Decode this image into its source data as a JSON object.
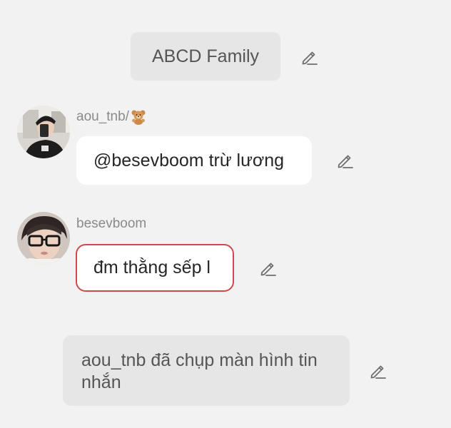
{
  "chat": {
    "group_name": "ABCD Family",
    "messages": [
      {
        "username": "aou_tnb/",
        "username_emoji": "teddy-bear",
        "text": "@besevboom trừ lương"
      },
      {
        "username": "besevboom",
        "text": "đm thằng sếp l"
      }
    ],
    "system_notice": "aou_tnb đã chụp màn hình tin nhắn"
  },
  "colors": {
    "background": "#f2f2f2",
    "pill": "#e6e6e6",
    "bubble": "#ffffff",
    "highlight_border": "#d04a4a",
    "muted_text": "#8a8a8a",
    "icon": "#6e6e6e"
  },
  "icons": {
    "edit": "pencil-edit-icon",
    "emoji": "teddy-bear-icon"
  }
}
